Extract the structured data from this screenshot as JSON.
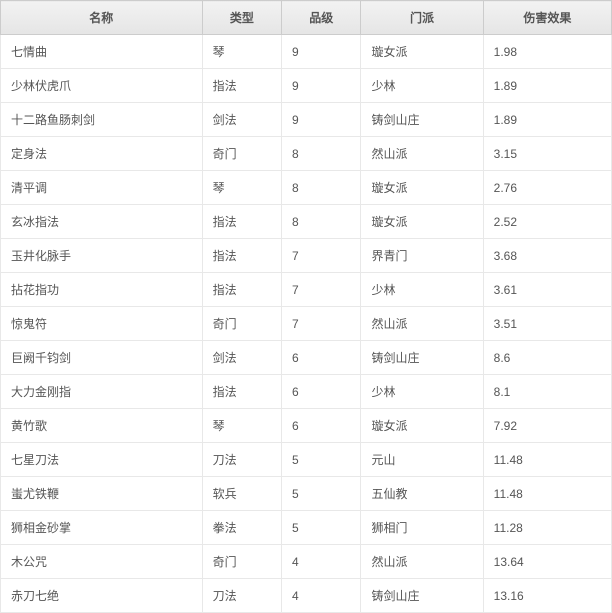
{
  "headers": {
    "name": "名称",
    "type": "类型",
    "rank": "品级",
    "sect": "门派",
    "effect": "伤害效果"
  },
  "rows": [
    {
      "name": "七情曲",
      "type": "琴",
      "rank": "9",
      "sect": "璇女派",
      "effect": "1.98"
    },
    {
      "name": "少林伏虎爪",
      "type": "指法",
      "rank": "9",
      "sect": "少林",
      "effect": "1.89"
    },
    {
      "name": "十二路鱼肠刺剑",
      "type": "剑法",
      "rank": "9",
      "sect": "铸剑山庄",
      "effect": "1.89"
    },
    {
      "name": "定身法",
      "type": "奇门",
      "rank": "8",
      "sect": "然山派",
      "effect": "3.15"
    },
    {
      "name": "清平调",
      "type": "琴",
      "rank": "8",
      "sect": "璇女派",
      "effect": "2.76"
    },
    {
      "name": "玄冰指法",
      "type": "指法",
      "rank": "8",
      "sect": "璇女派",
      "effect": "2.52"
    },
    {
      "name": "玉井化脉手",
      "type": "指法",
      "rank": "7",
      "sect": "界青门",
      "effect": "3.68"
    },
    {
      "name": "拈花指功",
      "type": "指法",
      "rank": "7",
      "sect": "少林",
      "effect": "3.61"
    },
    {
      "name": "惊鬼符",
      "type": "奇门",
      "rank": "7",
      "sect": "然山派",
      "effect": "3.51"
    },
    {
      "name": "巨阙千钧剑",
      "type": "剑法",
      "rank": "6",
      "sect": "铸剑山庄",
      "effect": "8.6"
    },
    {
      "name": "大力金刚指",
      "type": "指法",
      "rank": "6",
      "sect": "少林",
      "effect": "8.1"
    },
    {
      "name": "黄竹歌",
      "type": "琴",
      "rank": "6",
      "sect": "璇女派",
      "effect": "7.92"
    },
    {
      "name": "七星刀法",
      "type": "刀法",
      "rank": "5",
      "sect": "元山",
      "effect": "11.48"
    },
    {
      "name": "蚩尤铁鞭",
      "type": "软兵",
      "rank": "5",
      "sect": "五仙教",
      "effect": "11.48"
    },
    {
      "name": "狮相金砂掌",
      "type": "拳法",
      "rank": "5",
      "sect": "狮相门",
      "effect": "11.28"
    },
    {
      "name": "木公咒",
      "type": "奇门",
      "rank": "4",
      "sect": "然山派",
      "effect": "13.64"
    },
    {
      "name": "赤刀七绝",
      "type": "刀法",
      "rank": "4",
      "sect": "铸剑山庄",
      "effect": "13.16"
    }
  ]
}
